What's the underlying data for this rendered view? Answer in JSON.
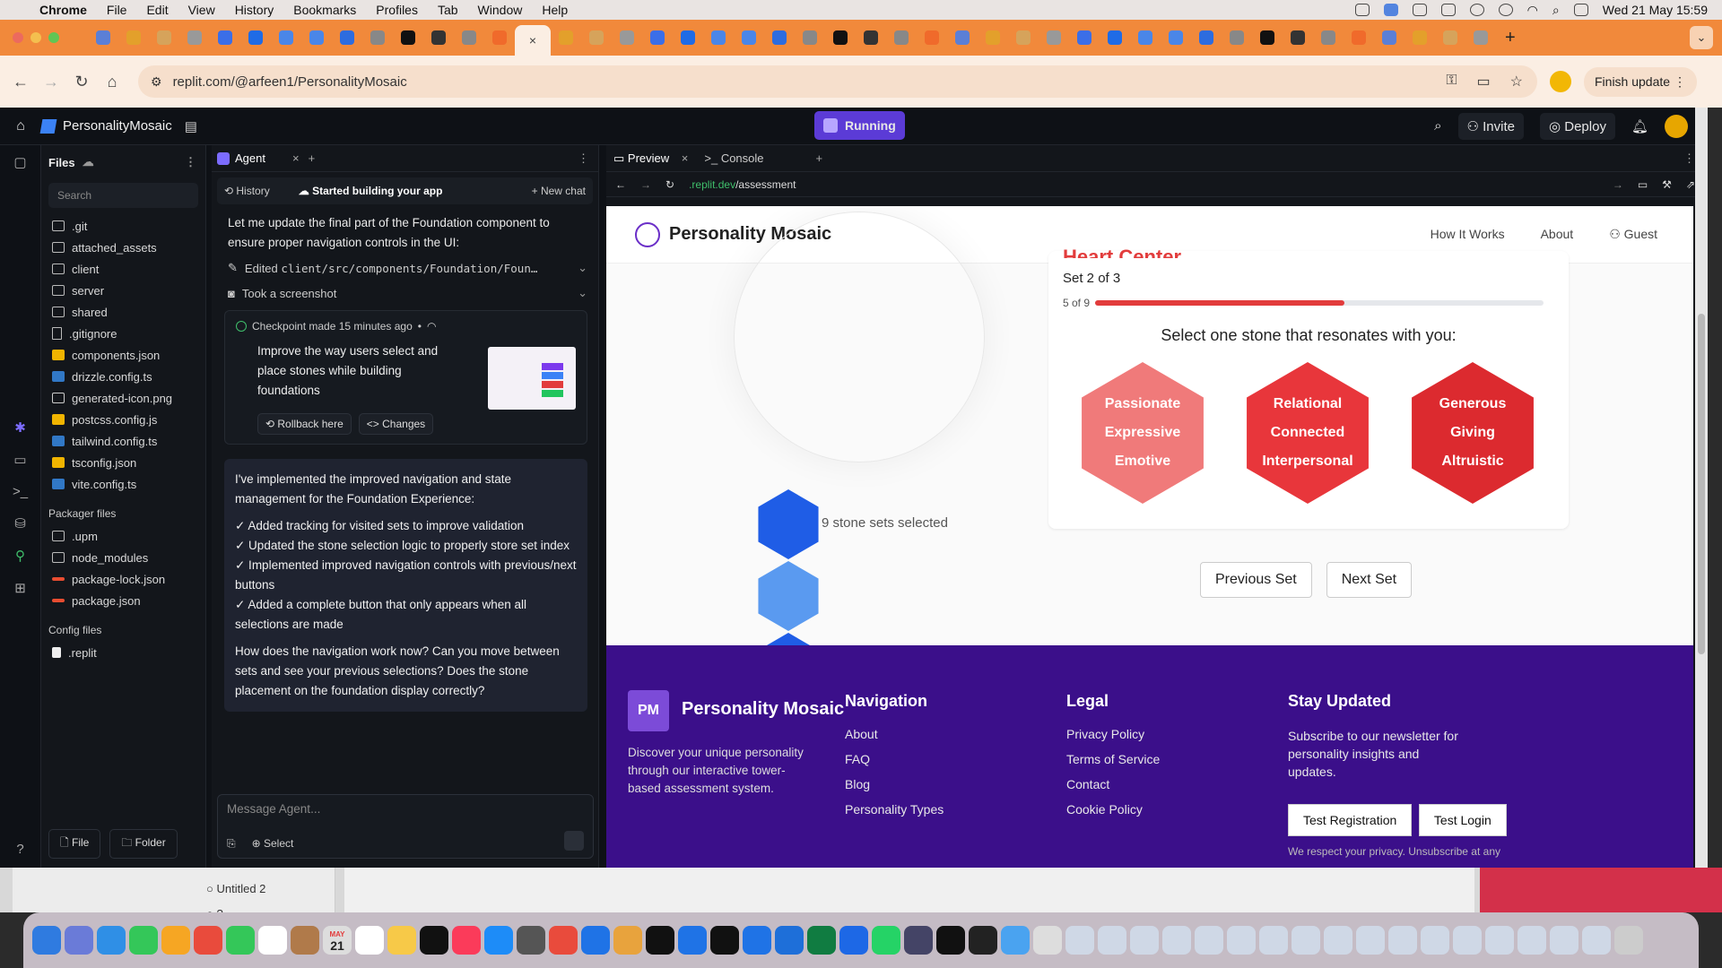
{
  "menubar": {
    "apple": "",
    "items": [
      "Chrome",
      "File",
      "Edit",
      "View",
      "History",
      "Bookmarks",
      "Profiles",
      "Tab",
      "Window",
      "Help"
    ],
    "datetime": "Wed 21 May  15:59"
  },
  "browser": {
    "tab_count": 46,
    "url": "replit.com/@arfeen1/PersonalityMosaic",
    "finish_update": "Finish update"
  },
  "replit": {
    "project_name": "PersonalityMosaic",
    "run_status": "Running",
    "invite": "Invite",
    "deploy": "Deploy"
  },
  "files": {
    "title": "Files",
    "search_placeholder": "Search",
    "items": [
      {
        "name": ".git",
        "icon": "folder-icon"
      },
      {
        "name": "attached_assets",
        "icon": "folder-icon"
      },
      {
        "name": "client",
        "icon": "folder-icon"
      },
      {
        "name": "server",
        "icon": "folder-icon"
      },
      {
        "name": "shared",
        "icon": "folder-icon"
      },
      {
        "name": ".gitignore",
        "icon": "file-icon"
      },
      {
        "name": "components.json",
        "icon": "json-icon"
      },
      {
        "name": "drizzle.config.ts",
        "icon": "ts-icon"
      },
      {
        "name": "generated-icon.png",
        "icon": "image-icon"
      },
      {
        "name": "postcss.config.js",
        "icon": "js-icon"
      },
      {
        "name": "tailwind.config.ts",
        "icon": "ts-icon"
      },
      {
        "name": "tsconfig.json",
        "icon": "json-icon"
      },
      {
        "name": "vite.config.ts",
        "icon": "ts-icon"
      }
    ],
    "packager_title": "Packager files",
    "packager_items": [
      {
        "name": ".upm",
        "icon": "folder-icon"
      },
      {
        "name": "node_modules",
        "icon": "folder-icon"
      },
      {
        "name": "package-lock.json",
        "icon": "npm-icon"
      },
      {
        "name": "package.json",
        "icon": "npm-icon"
      }
    ],
    "config_title": "Config files",
    "config_items": [
      {
        "name": ".replit",
        "icon": "replit-icon"
      }
    ],
    "new_file": "File",
    "new_folder": "Folder"
  },
  "agent": {
    "tab_label": "Agent",
    "history": "History",
    "status": "Started building your app",
    "new_chat": "+ New chat",
    "intro": "Let me update the final part of the Foundation component to ensure proper navigation controls in the UI:",
    "edited_label": "Edited",
    "edited_path": "client/src/components/Foundation/Foun…",
    "screenshot": "Took a screenshot",
    "checkpoint_head": "Checkpoint made 15 minutes ago",
    "checkpoint_text": "Improve the way users select and place stones while building foundations",
    "rollback": "Rollback here",
    "changes": "Changes",
    "reply_intro": "I've implemented the improved navigation and state management for the Foundation Experience:",
    "reply_items": [
      "✓ Added tracking for visited sets to improve validation",
      "✓ Updated the stone selection logic to properly store set index",
      "✓ Implemented improved navigation controls with previous/next buttons",
      "✓ Added a complete button that only appears when all selections are made"
    ],
    "reply_question": "How does the navigation work now? Can you move between sets and see your previous selections? Does the stone placement on the foundation display correctly?",
    "input_placeholder": "Message Agent...",
    "select": "Select"
  },
  "preview": {
    "tab_preview": "Preview",
    "tab_console": "Console",
    "url_domain": ".replit.dev",
    "url_path": "/assessment"
  },
  "site": {
    "brand": "Personality Mosaic",
    "nav": [
      "How It Works",
      "About",
      "Guest"
    ],
    "card_title": "Heart Center",
    "set_label": "Set 2 of 3",
    "progress_label": "5 of 9",
    "progress_fraction": 0.5556,
    "prompt": "Select one stone that resonates with you:",
    "stones": [
      {
        "lines": [
          "Passionate",
          "Expressive",
          "Emotive"
        ],
        "color": "#f07a7a"
      },
      {
        "lines": [
          "Relational",
          "Connected",
          "Interpersonal"
        ],
        "color": "#e8363b"
      },
      {
        "lines": [
          "Generous",
          "Giving",
          "Altruistic"
        ],
        "color": "#dc2a2f"
      }
    ],
    "tower_colors": [
      "#1f5de6",
      "#5a9af0",
      "#1f5de6",
      "#dc2a2f"
    ],
    "selected_text": "9 stone sets selected",
    "prev_set": "Previous Set",
    "next_set": "Next Set",
    "footer": {
      "initials": "PM",
      "brand": "Personality Mosaic",
      "desc": "Discover your unique personality through our interactive tower-based assessment system.",
      "nav_title": "Navigation",
      "nav_links": [
        "About",
        "FAQ",
        "Blog",
        "Personality Types"
      ],
      "legal_title": "Legal",
      "legal_links": [
        "Privacy Policy",
        "Terms of Service",
        "Contact",
        "Cookie Policy"
      ],
      "stay_title": "Stay Updated",
      "stay_text": "Subscribe to our newsletter for personality insights and updates.",
      "test_registration": "Test Registration",
      "test_login": "Test Login",
      "privacy_note": "We respect your privacy. Unsubscribe at any"
    }
  },
  "background_window": {
    "items": [
      "Untitled 2",
      "?"
    ]
  },
  "dock": {
    "calendar_month": "MAY",
    "calendar_day": "21"
  }
}
